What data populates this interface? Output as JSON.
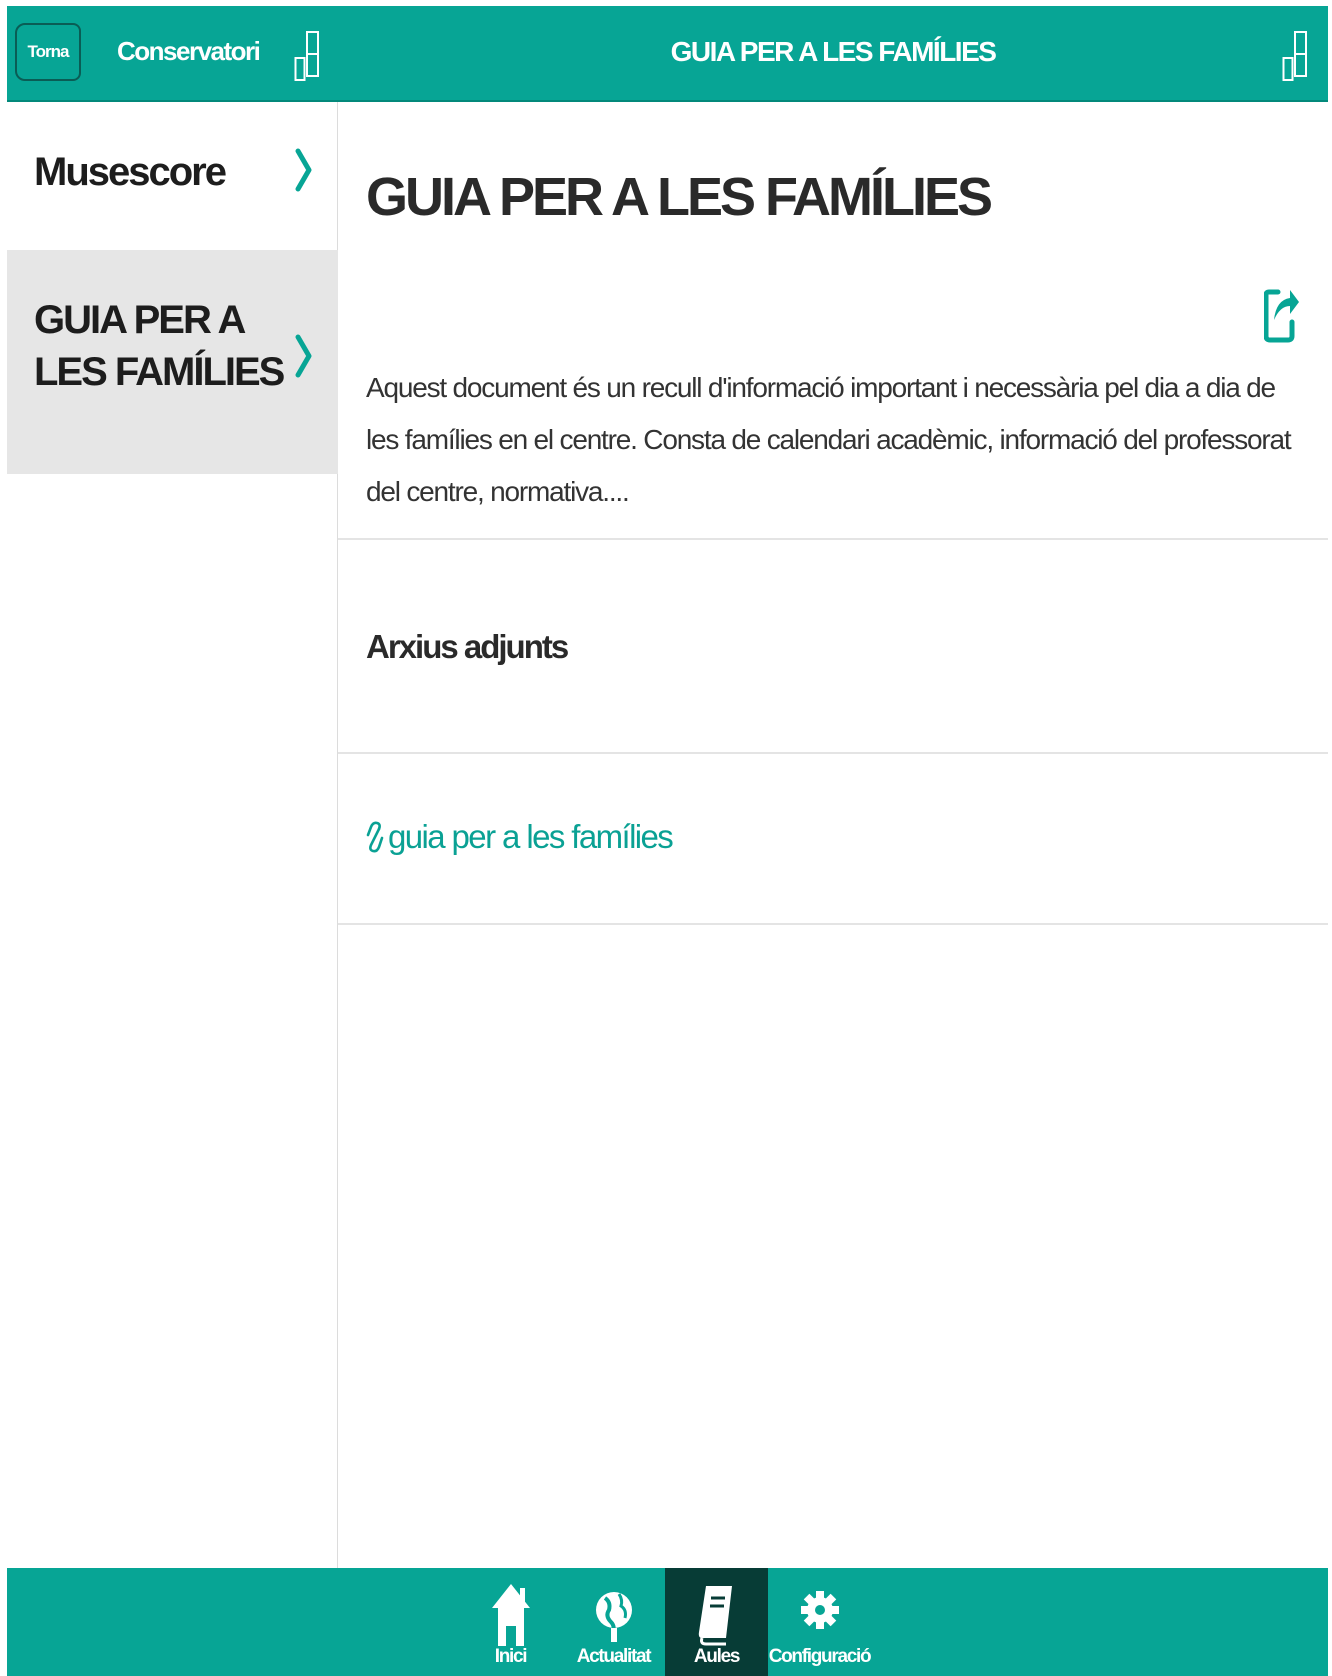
{
  "left_header": {
    "back_label": "Torna",
    "title": "Conservatori"
  },
  "menu": {
    "items": [
      {
        "label": "Musescore",
        "selected": false
      },
      {
        "label": "GUIA PER A LES FAMÍLIES",
        "selected": true
      }
    ]
  },
  "right_header": {
    "title": "GUIA PER A LES FAMÍLIES"
  },
  "content": {
    "title": "GUIA PER A LES FAMÍLIES",
    "description": "Aquest document és un recull d'informació important i necessària pel dia a dia de les famílies en el centre. Consta de calendari acadèmic, informació del professorat del centre, normativa....",
    "attachments_heading": "Arxius adjunts",
    "attachment_link": "guia per a les famílies"
  },
  "tabbar": {
    "tabs": [
      {
        "label": "Inici",
        "icon": "home-icon",
        "active": false
      },
      {
        "label": "Actualitat",
        "icon": "globe-icon",
        "active": false
      },
      {
        "label": "Aules",
        "icon": "book-icon",
        "active": true
      },
      {
        "label": "Configuració",
        "icon": "gear-icon",
        "active": false
      }
    ]
  },
  "colors": {
    "brand_teal": "#07a595",
    "active_tab": "#073c36",
    "selected_row": "#e6e6e6",
    "link": "#0aa194"
  }
}
